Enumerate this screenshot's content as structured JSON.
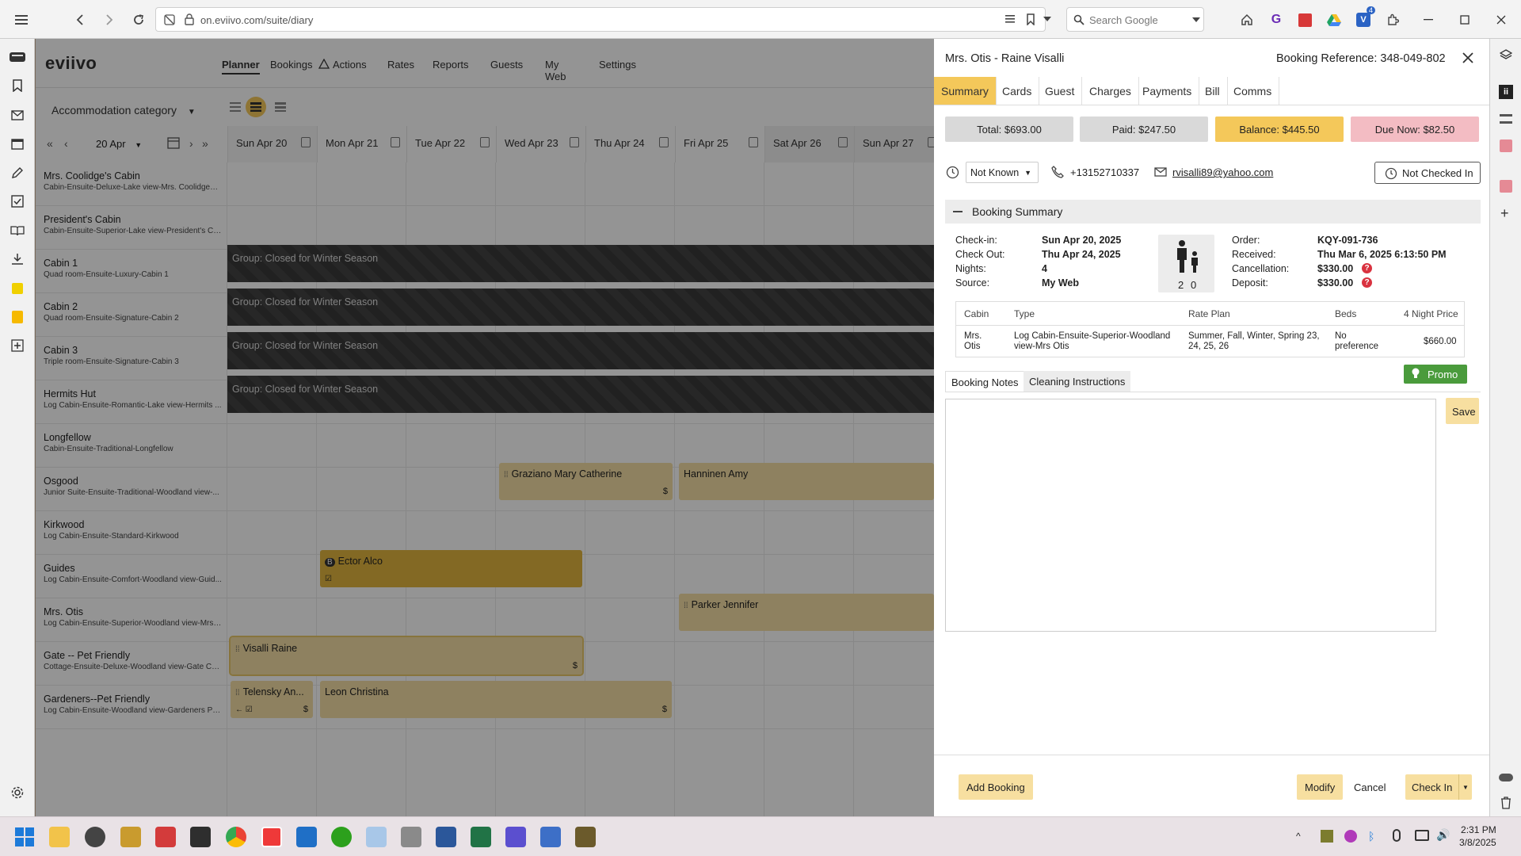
{
  "browser": {
    "url": "on.eviivo.com/suite/diary",
    "search_placeholder": "Search Google",
    "mail_badge": "4"
  },
  "app": {
    "logo": "eviivo",
    "nav": [
      "Planner",
      "Bookings",
      "Actions",
      "Rates",
      "Reports",
      "Guests",
      "My Web",
      "Settings"
    ],
    "category_select": "Accommodation category",
    "date_select": "20 Apr",
    "days": [
      {
        "label": "Sun Apr 20"
      },
      {
        "label": "Mon Apr 21"
      },
      {
        "label": "Tue Apr 22"
      },
      {
        "label": "Wed Apr 23"
      },
      {
        "label": "Thu Apr 24"
      },
      {
        "label": "Fri Apr 25"
      },
      {
        "label": "Sat Apr 26"
      },
      {
        "label": "Sun Apr 27"
      }
    ],
    "rooms": [
      {
        "name": "Mrs. Coolidge's Cabin",
        "sub": "Cabin-Ensuite-Deluxe-Lake view-Mrs. Coolidges ..."
      },
      {
        "name": "President's Cabin",
        "sub": "Cabin-Ensuite-Superior-Lake view-President's Ca..."
      },
      {
        "name": "Cabin 1",
        "sub": "Quad room-Ensuite-Luxury-Cabin 1"
      },
      {
        "name": "Cabin 2",
        "sub": "Quad room-Ensuite-Signature-Cabin 2"
      },
      {
        "name": "Cabin 3",
        "sub": "Triple room-Ensuite-Signature-Cabin 3"
      },
      {
        "name": "Hermits Hut",
        "sub": "Log Cabin-Ensuite-Romantic-Lake view-Hermits ..."
      },
      {
        "name": "Longfellow",
        "sub": "Cabin-Ensuite-Traditional-Longfellow"
      },
      {
        "name": "Osgood",
        "sub": "Junior Suite-Ensuite-Traditional-Woodland view-..."
      },
      {
        "name": "Kirkwood",
        "sub": "Log Cabin-Ensuite-Standard-Kirkwood"
      },
      {
        "name": "Guides",
        "sub": "Log Cabin-Ensuite-Comfort-Woodland view-Guid..."
      },
      {
        "name": "Mrs. Otis",
        "sub": "Log Cabin-Ensuite-Superior-Woodland view-Mrs ..."
      },
      {
        "name": "Gate -- Pet Friendly",
        "sub": "Cottage-Ensuite-Deluxe-Woodland view-Gate Cot..."
      },
      {
        "name": "Gardeners--Pet Friendly",
        "sub": "Log Cabin-Ensuite-Woodland view-Gardeners Pe..."
      }
    ],
    "closed_label": "Group: Closed for Winter Season",
    "bookings": {
      "graziano": "Graziano Mary Catherine",
      "hanninen": "Hanninen Amy",
      "ector": "Ector Alco",
      "parker": "Parker Jennifer",
      "visalli": "Visalli Raine",
      "telensky": "Telensky An...",
      "leon": "Leon Christina",
      "dollar": "$"
    }
  },
  "panel": {
    "title": "Mrs. Otis - Raine Visalli",
    "reference": "Booking Reference: 348-049-802",
    "tabs": [
      "Summary",
      "Cards",
      "Guest",
      "Charges",
      "Payments",
      "Bill",
      "Comms"
    ],
    "totals": {
      "total": "Total: $693.00",
      "paid": "Paid: $247.50",
      "balance": "Balance: $445.50",
      "due_now": "Due Now: $82.50"
    },
    "arrival_time": "Not Known",
    "phone": "+13152710337",
    "email": "rvisalli89@yahoo.com",
    "check_status": "Not Checked In",
    "summary_header": "Booking Summary",
    "details": {
      "checkin_label": "Check-in:",
      "checkin": "Sun Apr 20, 2025",
      "checkout_label": "Check Out:",
      "checkout": "Thu Apr 24, 2025",
      "nights_label": "Nights:",
      "nights": "4",
      "source_label": "Source:",
      "source": "My Web",
      "order_label": "Order:",
      "order": "KQY-091-736",
      "received_label": "Received:",
      "received": "Thu Mar 6, 2025 6:13:50 PM",
      "cancellation_label": "Cancellation:",
      "cancellation": "$330.00",
      "deposit_label": "Deposit:",
      "deposit": "$330.00",
      "adults": "2",
      "children": "0"
    },
    "table": {
      "headers": [
        "Cabin",
        "Type",
        "Rate Plan",
        "Beds",
        "4 Night Price"
      ],
      "row": {
        "cabin": "Mrs. Otis",
        "type": "Log Cabin-Ensuite-Superior-Woodland view-Mrs Otis",
        "rate_plan": "Summer, Fall, Winter, Spring 23, 24, 25, 26",
        "beds": "No preference",
        "price": "$660.00"
      }
    },
    "promo": "Promo",
    "note_tabs": [
      "Booking Notes",
      "Cleaning Instructions"
    ],
    "save": "Save",
    "footer": {
      "add_booking": "Add Booking",
      "modify": "Modify",
      "cancel": "Cancel",
      "check_in": "Check In"
    }
  },
  "taskbar": {
    "time": "2:31 PM",
    "date": "3/8/2025"
  }
}
